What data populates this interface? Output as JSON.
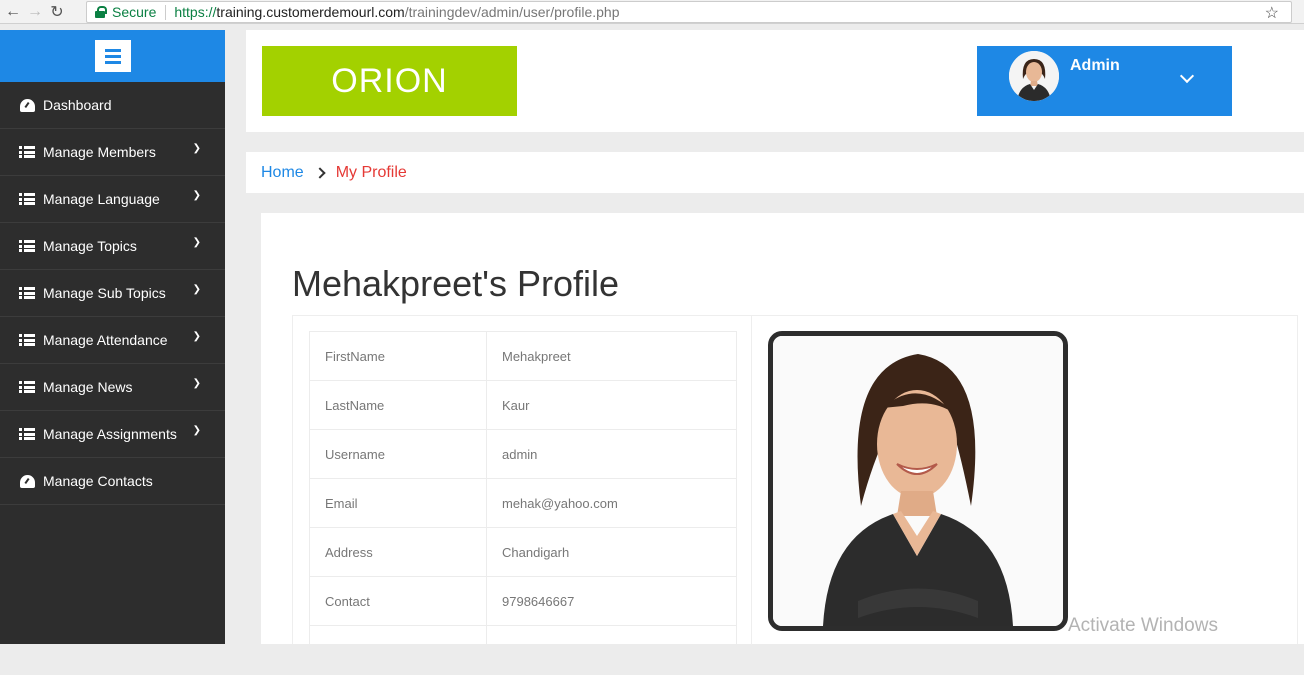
{
  "browser": {
    "secure_label": "Secure",
    "url_scheme": "https://",
    "url_host": "training.customerdemourl.com",
    "url_path": "/trainingdev/admin/user/profile.php"
  },
  "sidebar": {
    "accent_color": "#1e88e5",
    "items": [
      {
        "label": "Dashboard",
        "icon": "dashboard-icon",
        "has_submenu": false
      },
      {
        "label": "Manage Members",
        "icon": "list-icon",
        "has_submenu": true
      },
      {
        "label": "Manage Language",
        "icon": "list-icon",
        "has_submenu": true
      },
      {
        "label": "Manage Topics",
        "icon": "list-icon",
        "has_submenu": true
      },
      {
        "label": "Manage Sub Topics",
        "icon": "list-icon",
        "has_submenu": true
      },
      {
        "label": "Manage Attendance",
        "icon": "list-icon",
        "has_submenu": true
      },
      {
        "label": "Manage News",
        "icon": "list-icon",
        "has_submenu": true
      },
      {
        "label": "Manage Assignments",
        "icon": "list-icon",
        "has_submenu": true
      },
      {
        "label": "Manage Contacts",
        "icon": "dashboard-icon",
        "has_submenu": false
      }
    ]
  },
  "header": {
    "logo_text": "ORION",
    "logo_color": "#a3d100",
    "user_name": "Admin"
  },
  "breadcrumb": {
    "home": "Home",
    "current": "My Profile"
  },
  "profile": {
    "title": "Mehakpreet's Profile",
    "fields": [
      {
        "label": "FirstName",
        "value": "Mehakpreet"
      },
      {
        "label": "LastName",
        "value": "Kaur"
      },
      {
        "label": "Username",
        "value": "admin"
      },
      {
        "label": "Email",
        "value": "mehak@yahoo.com"
      },
      {
        "label": "Address",
        "value": "Chandigarh"
      },
      {
        "label": "Contact",
        "value": "9798646667"
      }
    ]
  },
  "watermark": "Activate Windows"
}
